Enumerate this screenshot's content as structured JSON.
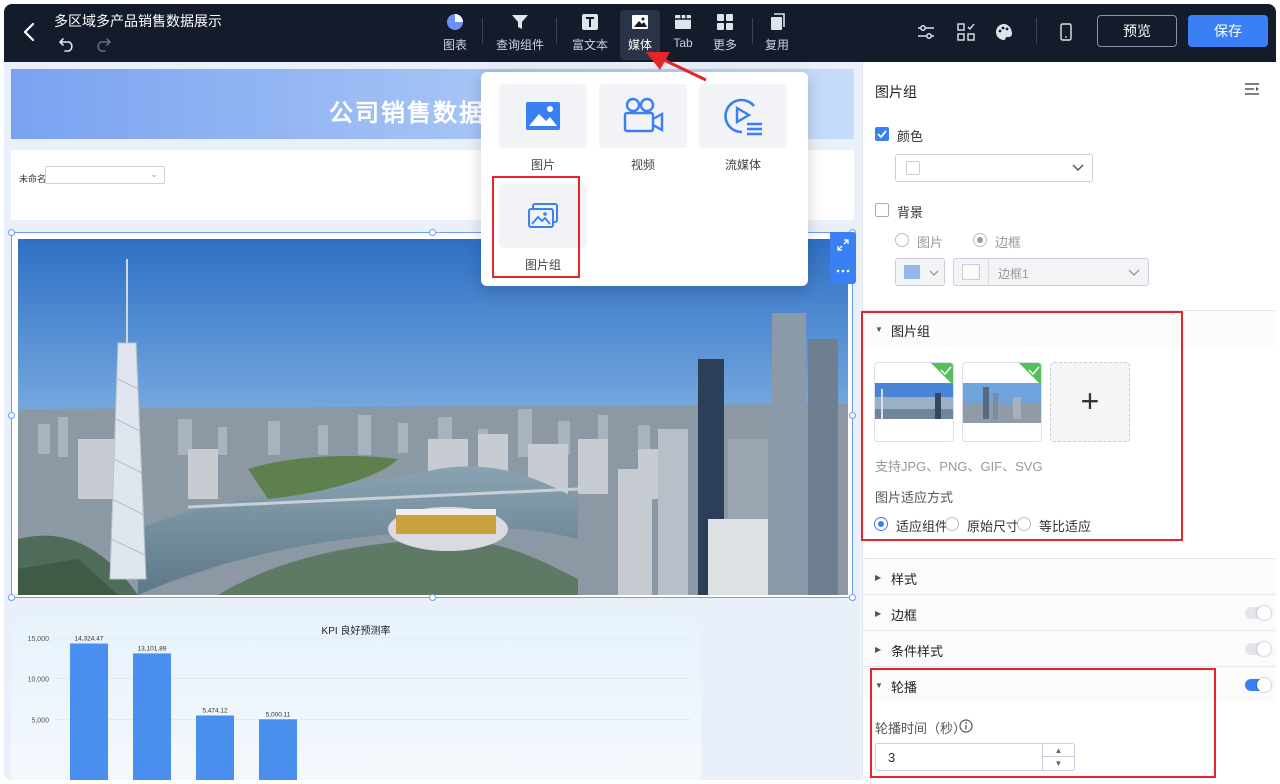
{
  "header": {
    "title": "多区域多产品销售数据展示",
    "tools": [
      {
        "label": "图表",
        "icon": "pie-chart-icon"
      },
      {
        "label": "查询组件",
        "icon": "filter-icon"
      },
      {
        "label": "富文本",
        "icon": "text-icon"
      },
      {
        "label": "媒体",
        "icon": "image-icon"
      },
      {
        "label": "Tab",
        "icon": "tab-icon"
      },
      {
        "label": "更多",
        "icon": "grid-icon"
      },
      {
        "label": "复用",
        "icon": "copy-icon"
      }
    ],
    "preview_label": "预览",
    "save_label": "保存"
  },
  "canvas": {
    "banner_title": "公司销售数据",
    "filter_label": "未命名",
    "chart_title": "KPI 良好预测率"
  },
  "media_menu": {
    "items": [
      "图片",
      "视频",
      "流媒体",
      "图片组"
    ]
  },
  "panel": {
    "title": "图片组",
    "color_label": "颜色",
    "background_label": "背景",
    "bg_image_label": "图片",
    "bg_border_label": "边框",
    "border_select": "边框1",
    "section_image_group": "图片组",
    "formats_hint": "支持JPG、PNG、GIF、SVG",
    "fit_label": "图片适应方式",
    "fit_options": [
      "适应组件",
      "原始尺寸",
      "等比适应"
    ],
    "section_style": "样式",
    "section_border": "边框",
    "section_condition": "条件样式",
    "section_carousel": "轮播",
    "carousel_time_label": "轮播时间（秒）",
    "carousel_time_value": "3"
  },
  "colors": {
    "topbar": "#141b2b",
    "accent": "#3b7ff5",
    "highlight": "#e6252b",
    "bar": "#4a8ff0"
  },
  "chart_data": {
    "type": "bar",
    "title": "KPI 良好预测率",
    "y_ticks": [
      "15,000",
      "10,000",
      "5,000"
    ],
    "ylim": [
      0,
      15000
    ],
    "values": [
      14324.47,
      13101.89,
      5474.12,
      5000.11
    ],
    "value_labels": [
      "14,324.47",
      "13,101.89",
      "5,474.12",
      "5,000.11"
    ]
  }
}
